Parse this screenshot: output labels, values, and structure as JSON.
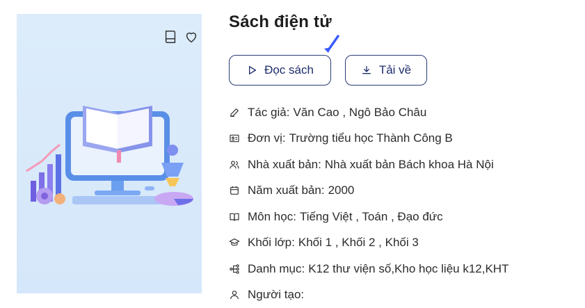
{
  "book": {
    "title": "Sách điện tử",
    "actions": {
      "read_label": "Đọc sách",
      "download_label": "Tải về"
    },
    "cover_icons": [
      "book-icon",
      "heart-icon"
    ],
    "details": [
      {
        "icon": "pen-icon",
        "label": "Tác giả:",
        "value": "Văn Cao , Ngô Bảo Châu"
      },
      {
        "icon": "id-card-icon",
        "label": "Đơn vị:",
        "value": "Trường tiểu học Thành Công B"
      },
      {
        "icon": "users-icon",
        "label": "Nhà xuất bản:",
        "value": "Nhà xuất bản Bách khoa Hà Nội"
      },
      {
        "icon": "calendar-icon",
        "label": "Năm xuất bản:",
        "value": "2000"
      },
      {
        "icon": "open-book-icon",
        "label": "Môn học:",
        "value": "Tiếng Việt , Toán , Đạo đức"
      },
      {
        "icon": "graduation-cap-icon",
        "label": "Khối lớp:",
        "value": "Khối 1 , Khối 2 , Khối 3"
      },
      {
        "icon": "hierarchy-icon",
        "label": "Danh mục:",
        "value": "K12 thư viện số,Kho học liệu k12,KHT"
      },
      {
        "icon": "user-icon",
        "label": "Người tạo:",
        "value": ""
      }
    ]
  },
  "colors": {
    "accent": "#1e2c6b",
    "arrow": "#3b5bff",
    "cover_bg": "#d8e9fb"
  }
}
